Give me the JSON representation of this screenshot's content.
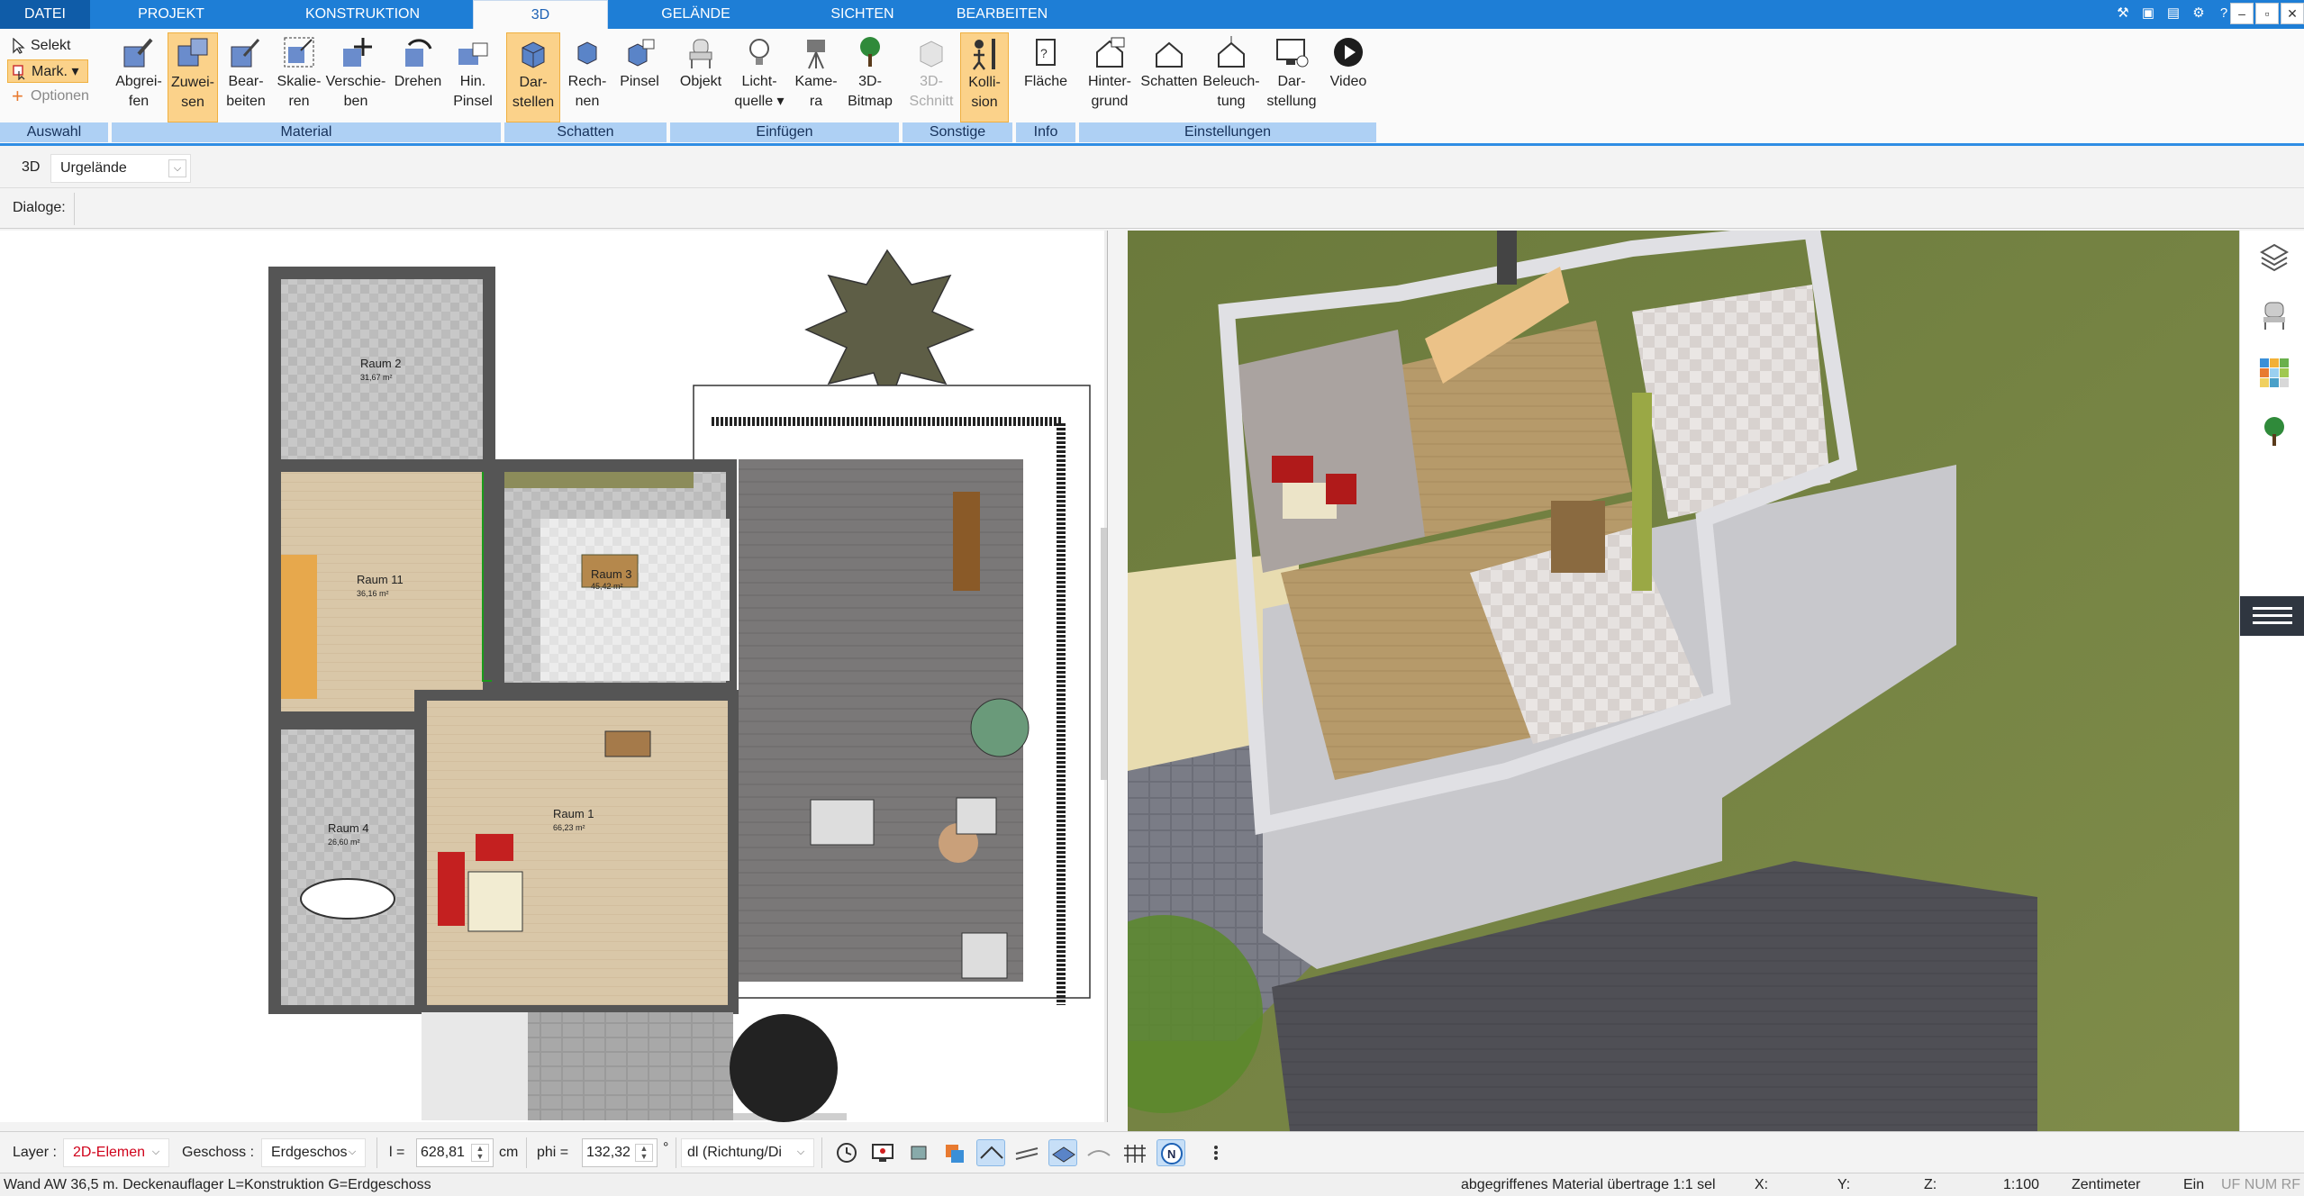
{
  "menu": {
    "tabs": [
      {
        "label": "DATEI"
      },
      {
        "label": "PROJEKT"
      },
      {
        "label": "KONSTRUKTION"
      },
      {
        "label": "3D"
      },
      {
        "label": "GELÄNDE"
      },
      {
        "label": "SICHTEN"
      },
      {
        "label": "BEARBEITEN"
      }
    ],
    "active_tab": "3D"
  },
  "ribbon": {
    "selection": {
      "select_label": "Selekt",
      "mark_label": "Mark.",
      "options_label": "Optionen",
      "group": "Auswahl"
    },
    "material": {
      "group": "Material",
      "buttons": [
        {
          "label": "Abgrei-\nfen",
          "icon": "eyedropper-icon"
        },
        {
          "label": "Zuwei-\nsen",
          "icon": "assign-material-icon",
          "active": true
        },
        {
          "label": "Bear-\nbeiten",
          "icon": "edit-material-icon"
        },
        {
          "label": "Skalie-\nren",
          "icon": "scale-icon"
        },
        {
          "label": "Verschie-\nben",
          "icon": "move-icon"
        },
        {
          "label": "Drehen",
          "icon": "rotate-icon"
        },
        {
          "label": "Hin.\nPinsel",
          "icon": "brush-icon"
        }
      ]
    },
    "schatten": {
      "group": "Schatten",
      "buttons": [
        {
          "label": "Dar-\nstellen",
          "icon": "render-shadow-icon",
          "active": true
        },
        {
          "label": "Rech-\nnen",
          "icon": "calculate-shadow-icon"
        },
        {
          "label": "Pinsel",
          "icon": "shadow-brush-icon"
        }
      ]
    },
    "einfuegen": {
      "group": "Einfügen",
      "buttons": [
        {
          "label": "Objekt",
          "icon": "chair-object-icon"
        },
        {
          "label": "Licht-\nquelle ▾",
          "icon": "light-bulb-icon"
        },
        {
          "label": "Kame-\nra",
          "icon": "camera-icon"
        },
        {
          "label": "3D-\nBitmap",
          "icon": "tree-bitmap-icon"
        }
      ]
    },
    "sonstige": {
      "group": "Sonstige",
      "buttons": [
        {
          "label": "3D-\nSchnitt",
          "icon": "section-cut-icon",
          "disabled": true
        },
        {
          "label": "Kolli-\nsion",
          "icon": "collision-icon",
          "active": true
        }
      ]
    },
    "info": {
      "group": "Info",
      "buttons": [
        {
          "label": "Fläche",
          "icon": "area-icon"
        }
      ]
    },
    "einstellungen": {
      "group": "Einstellungen",
      "buttons": [
        {
          "label": "Hinter-\ngrund",
          "icon": "background-icon"
        },
        {
          "label": "Schatten",
          "icon": "shadow-house-icon"
        },
        {
          "label": "Beleuch-\ntung",
          "icon": "lighting-house-icon"
        },
        {
          "label": "Dar-\nstellung",
          "icon": "display-settings-icon"
        },
        {
          "label": "Video",
          "icon": "play-video-icon"
        }
      ]
    }
  },
  "toolbar": {
    "view_label": "3D",
    "terrain_select": "Urgelände",
    "dialoge_label": "Dialoge:"
  },
  "plan": {
    "rooms": [
      {
        "name": "Raum 2",
        "area": "31,67 m²"
      },
      {
        "name": "Raum 11",
        "area": "36,16 m²"
      },
      {
        "name": "Raum 3",
        "area": "45,42 m²"
      },
      {
        "name": "Raum 1",
        "area": "66,23 m²"
      },
      {
        "name": "Raum 4",
        "area": "26,60 m²"
      }
    ]
  },
  "bottom": {
    "layer_label": "Layer :",
    "layer_value": "2D-Elemen",
    "geschoss_label": "Geschoss :",
    "geschoss_value": "Erdgeschos",
    "l_label": "l =",
    "l_value": "628,81",
    "l_unit": "cm",
    "phi_label": "phi =",
    "phi_value": "132,32",
    "phi_unit": "°",
    "dl_value": "dl (Richtung/Di"
  },
  "status": {
    "left": "Wand AW 36,5 m. Deckenauflager L=Konstruktion G=Erdgeschoss",
    "message": "abgegriffenes Material übertrage 1:1 sel",
    "x_label": "X:",
    "y_label": "Y:",
    "z_label": "Z:",
    "scale": "1:100",
    "unit": "Zentimeter",
    "mode": "Ein",
    "flags": "UF NUM RF"
  },
  "colors": {
    "accent": "#1e7ed6",
    "ribbon_group": "#aed0f4",
    "active_button": "#fbd28a",
    "red_text": "#d0021b"
  }
}
